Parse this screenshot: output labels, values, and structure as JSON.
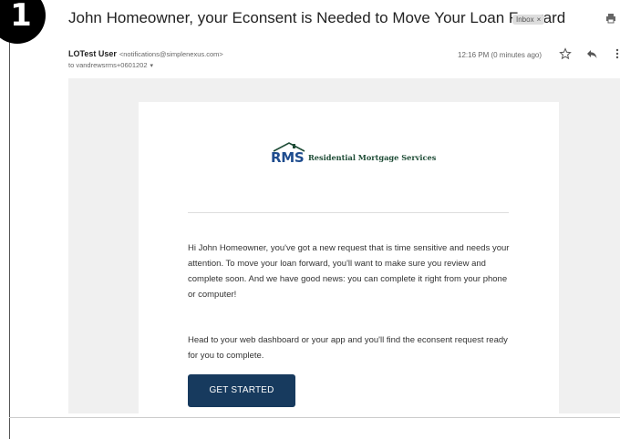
{
  "step": {
    "number": "1"
  },
  "email": {
    "subject": "John Homeowner, your Econsent is Needed to Move Your Loan Forward",
    "label_chip": "Inbox",
    "label_chip_close": "×",
    "sender_name": "LOTest User",
    "sender_email": "<notifications@simplenexus.com>",
    "recipient": "to vandrewsrms+0601202",
    "recipient_caret": "▾",
    "timestamp": "12:16 PM (0 minutes ago)",
    "icons": [
      "print-icon",
      "star-icon",
      "reply-icon",
      "more-vert-icon"
    ]
  },
  "body": {
    "logo_mark": "RMS",
    "logo_text": "Residential Mortgage Services",
    "paragraph_1": "Hi John Homeowner, you've got a new request that is time sensitive and needs your attention. To move your loan forward, you'll want to make sure you review and complete soon. And we have good news: you can complete it right from your phone or computer!",
    "paragraph_2": "Head to your web dashboard or your app and you'll find the econsent request ready for you to complete.",
    "cta_label": "GET STARTED"
  },
  "colors": {
    "brand_green": "#1e4c36",
    "brand_blue": "#1e4c8e",
    "button_bg": "#173a5e",
    "email_bg": "#f0f0f0"
  }
}
